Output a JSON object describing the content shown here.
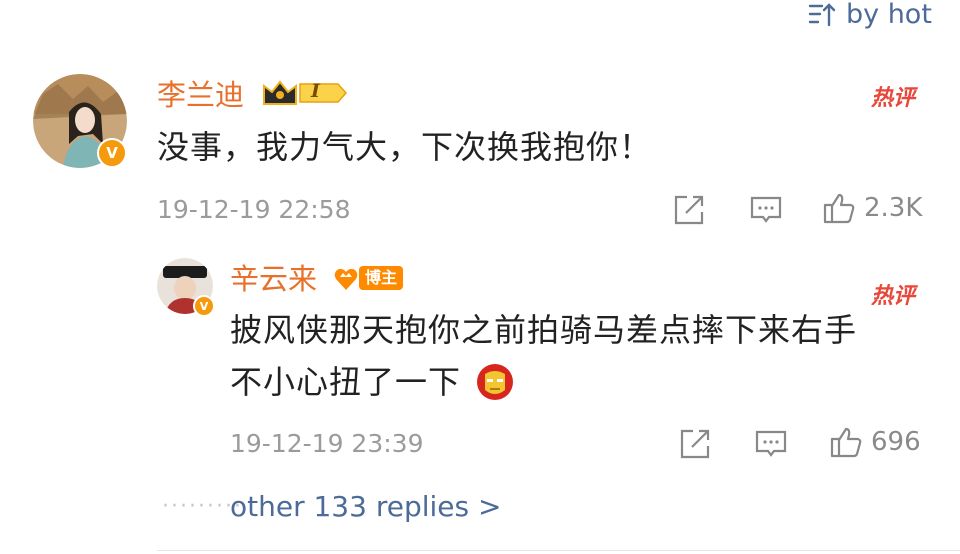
{
  "sort": {
    "label": "by hot",
    "icon": "sort-icon"
  },
  "comment": {
    "username": "李兰迪",
    "level_badge": "I",
    "text": "没事，我力气大，下次换我抱你！",
    "time": "19-12-19 22:58",
    "hot_label": "热评",
    "likes": "2.3K"
  },
  "reply": {
    "username": "辛云来",
    "blogger_label": "博主",
    "text_line1": "披风侠那天抱你之前拍骑马差点摔下来右手",
    "text_line2": "不小心扭了一下",
    "emoji": "iron-man-emoji",
    "time": "19-12-19 23:39",
    "hot_label": "热评",
    "likes": "696"
  },
  "more_replies": {
    "dots": "·········",
    "label": "other 133 replies >"
  },
  "colors": {
    "username": "#e8702a",
    "link": "#4d6b98",
    "hot": "#e8473a",
    "verified": "#f59a0c"
  }
}
